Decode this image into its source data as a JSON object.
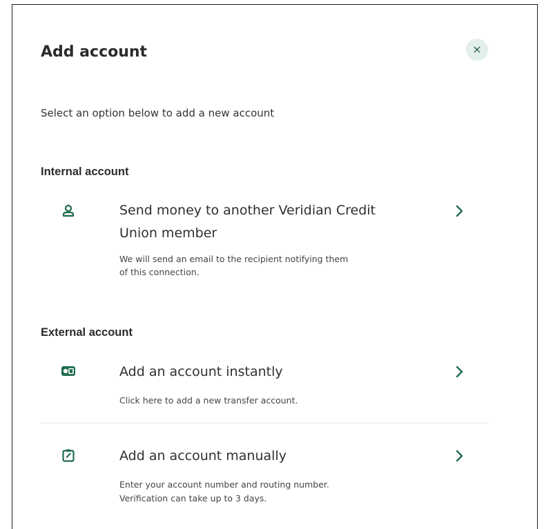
{
  "dialog": {
    "title": "Add account",
    "close_label": "×",
    "subtitle": "Select an option below to add a new account"
  },
  "sections": {
    "internal": {
      "heading": "Internal account",
      "options": [
        {
          "title_line1": "Send money to another Veridian Credit",
          "title_line2": "Union member",
          "desc_line1": "We will send an email to the recipient notifying them",
          "desc_line2": "of this connection.",
          "icon": "person-icon"
        }
      ]
    },
    "external": {
      "heading": "External account",
      "options": [
        {
          "title": "Add an account instantly",
          "desc": "Click here to add a new transfer account.",
          "icon": "bank-card-icon"
        },
        {
          "title": "Add an account manually",
          "desc_line1": "Enter your account number and routing number.",
          "desc_line2": "Verification can take up to 3 days.",
          "icon": "edit-clipboard-icon"
        }
      ]
    }
  },
  "colors": {
    "accent": "#1f6b4c",
    "close_bg": "#e3efe9"
  }
}
